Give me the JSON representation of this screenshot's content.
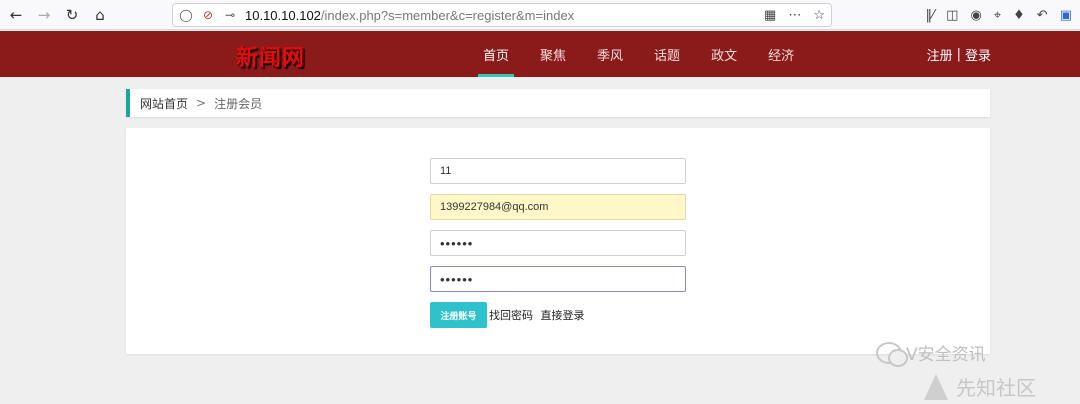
{
  "browser": {
    "url_host": "10.10.10.102",
    "url_path": "/index.php?s=member&c=register&m=index",
    "icons": [
      "back-icon",
      "forward-icon",
      "reload-icon",
      "home-icon",
      "shield-icon",
      "insecure-lock-icon",
      "key-icon",
      "qr-code-icon",
      "more-icon",
      "bookmark-star-icon",
      "library-icon",
      "sidebar-icon",
      "account-icon",
      "screenshot-icon",
      "chat-icon",
      "undo-icon",
      "extension-icon"
    ]
  },
  "site": {
    "logo": "新闻网",
    "nav": [
      {
        "label": "首页",
        "active": true
      },
      {
        "label": "聚焦"
      },
      {
        "label": "季风"
      },
      {
        "label": "话题"
      },
      {
        "label": "政文"
      },
      {
        "label": "经济"
      }
    ],
    "auth": {
      "register": "注册",
      "sep": "|",
      "login": "登录"
    }
  },
  "breadcrumb": {
    "home": "网站首页",
    "sep": ">",
    "current": "注册会员"
  },
  "form": {
    "username": "11",
    "email": "1399227984@qq.com",
    "password": "••••••",
    "password_confirm": "••••••",
    "submit": "注册账号",
    "forgot": "找回密码",
    "direct_login": "直接登录"
  },
  "watermark": {
    "wechat": "V安全资讯",
    "site": "先知社区"
  },
  "colors": {
    "header": "#8b1a1a",
    "accent": "#2fc2cc",
    "breadcrumb_bar": "#16a89a"
  }
}
